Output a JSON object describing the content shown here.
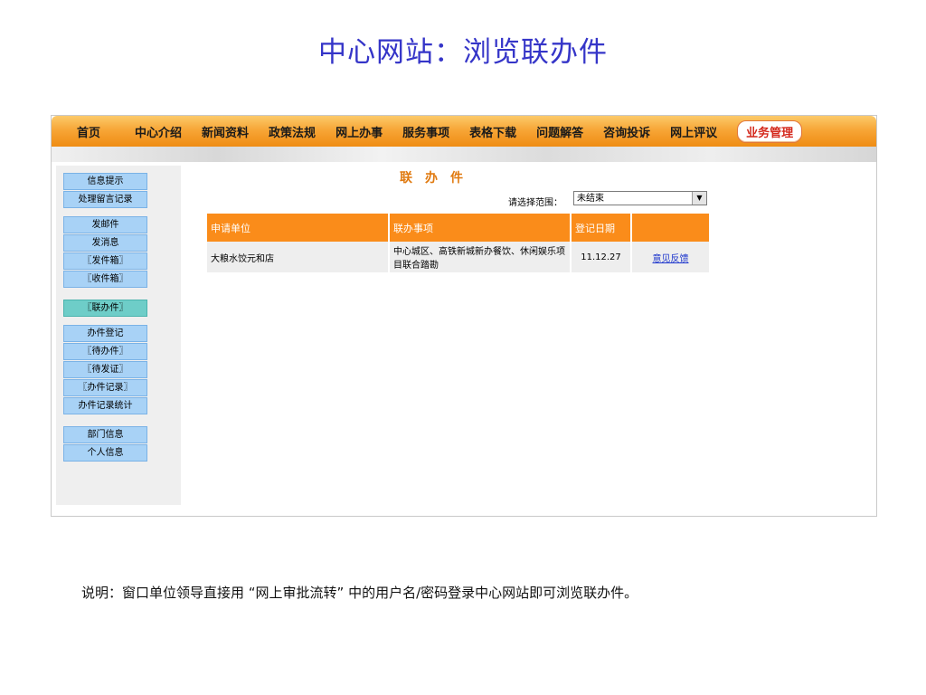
{
  "page_title": "中心网站：浏览联办件",
  "nav": {
    "items": [
      "首页",
      "中心介绍",
      "新闻资料",
      "政策法规",
      "网上办事",
      "服务事项",
      "表格下载",
      "问题解答",
      "咨询投诉",
      "网上评议"
    ],
    "active": "业务管理"
  },
  "sidebar": {
    "groups": [
      [
        "信息提示",
        "处理留言记录"
      ],
      [
        "发邮件",
        "发消息",
        "〖发件箱〗",
        "〖收件箱〗"
      ],
      [
        "〖联办件〗"
      ],
      [
        "办件登记",
        "〖待办件〗",
        "〖待发证〗",
        "〖办件记录〗",
        "办件记录统计"
      ],
      [
        "部门信息",
        "个人信息"
      ]
    ],
    "current": "〖联办件〗"
  },
  "content": {
    "section_title": "联办件",
    "scope_label": "请选择范围：",
    "scope_value": "未结束"
  },
  "table": {
    "headers": [
      "申请单位",
      "联办事项",
      "登记日期",
      ""
    ],
    "rows": [
      {
        "unit": "大粮水饺元和店",
        "matter": "中心城区、高铁新城新办餐饮、休闲娱乐项目联合踏勘",
        "date": "11.12.27",
        "action": "意见反馈"
      }
    ]
  },
  "caption": "说明：窗口单位领导直接用 “网上审批流转” 中的用户名/密码登录中心网站即可浏览联办件。",
  "colors": {
    "title": "#3535c8",
    "nav_orange": "#f7a637",
    "header_orange": "#fa8c1a",
    "sidebar_blue": "#a8d2f6",
    "sidebar_current": "#6ecdc8",
    "section_title": "#e07a10",
    "link": "#1a33cc",
    "active_nav_text": "#d4281c"
  }
}
